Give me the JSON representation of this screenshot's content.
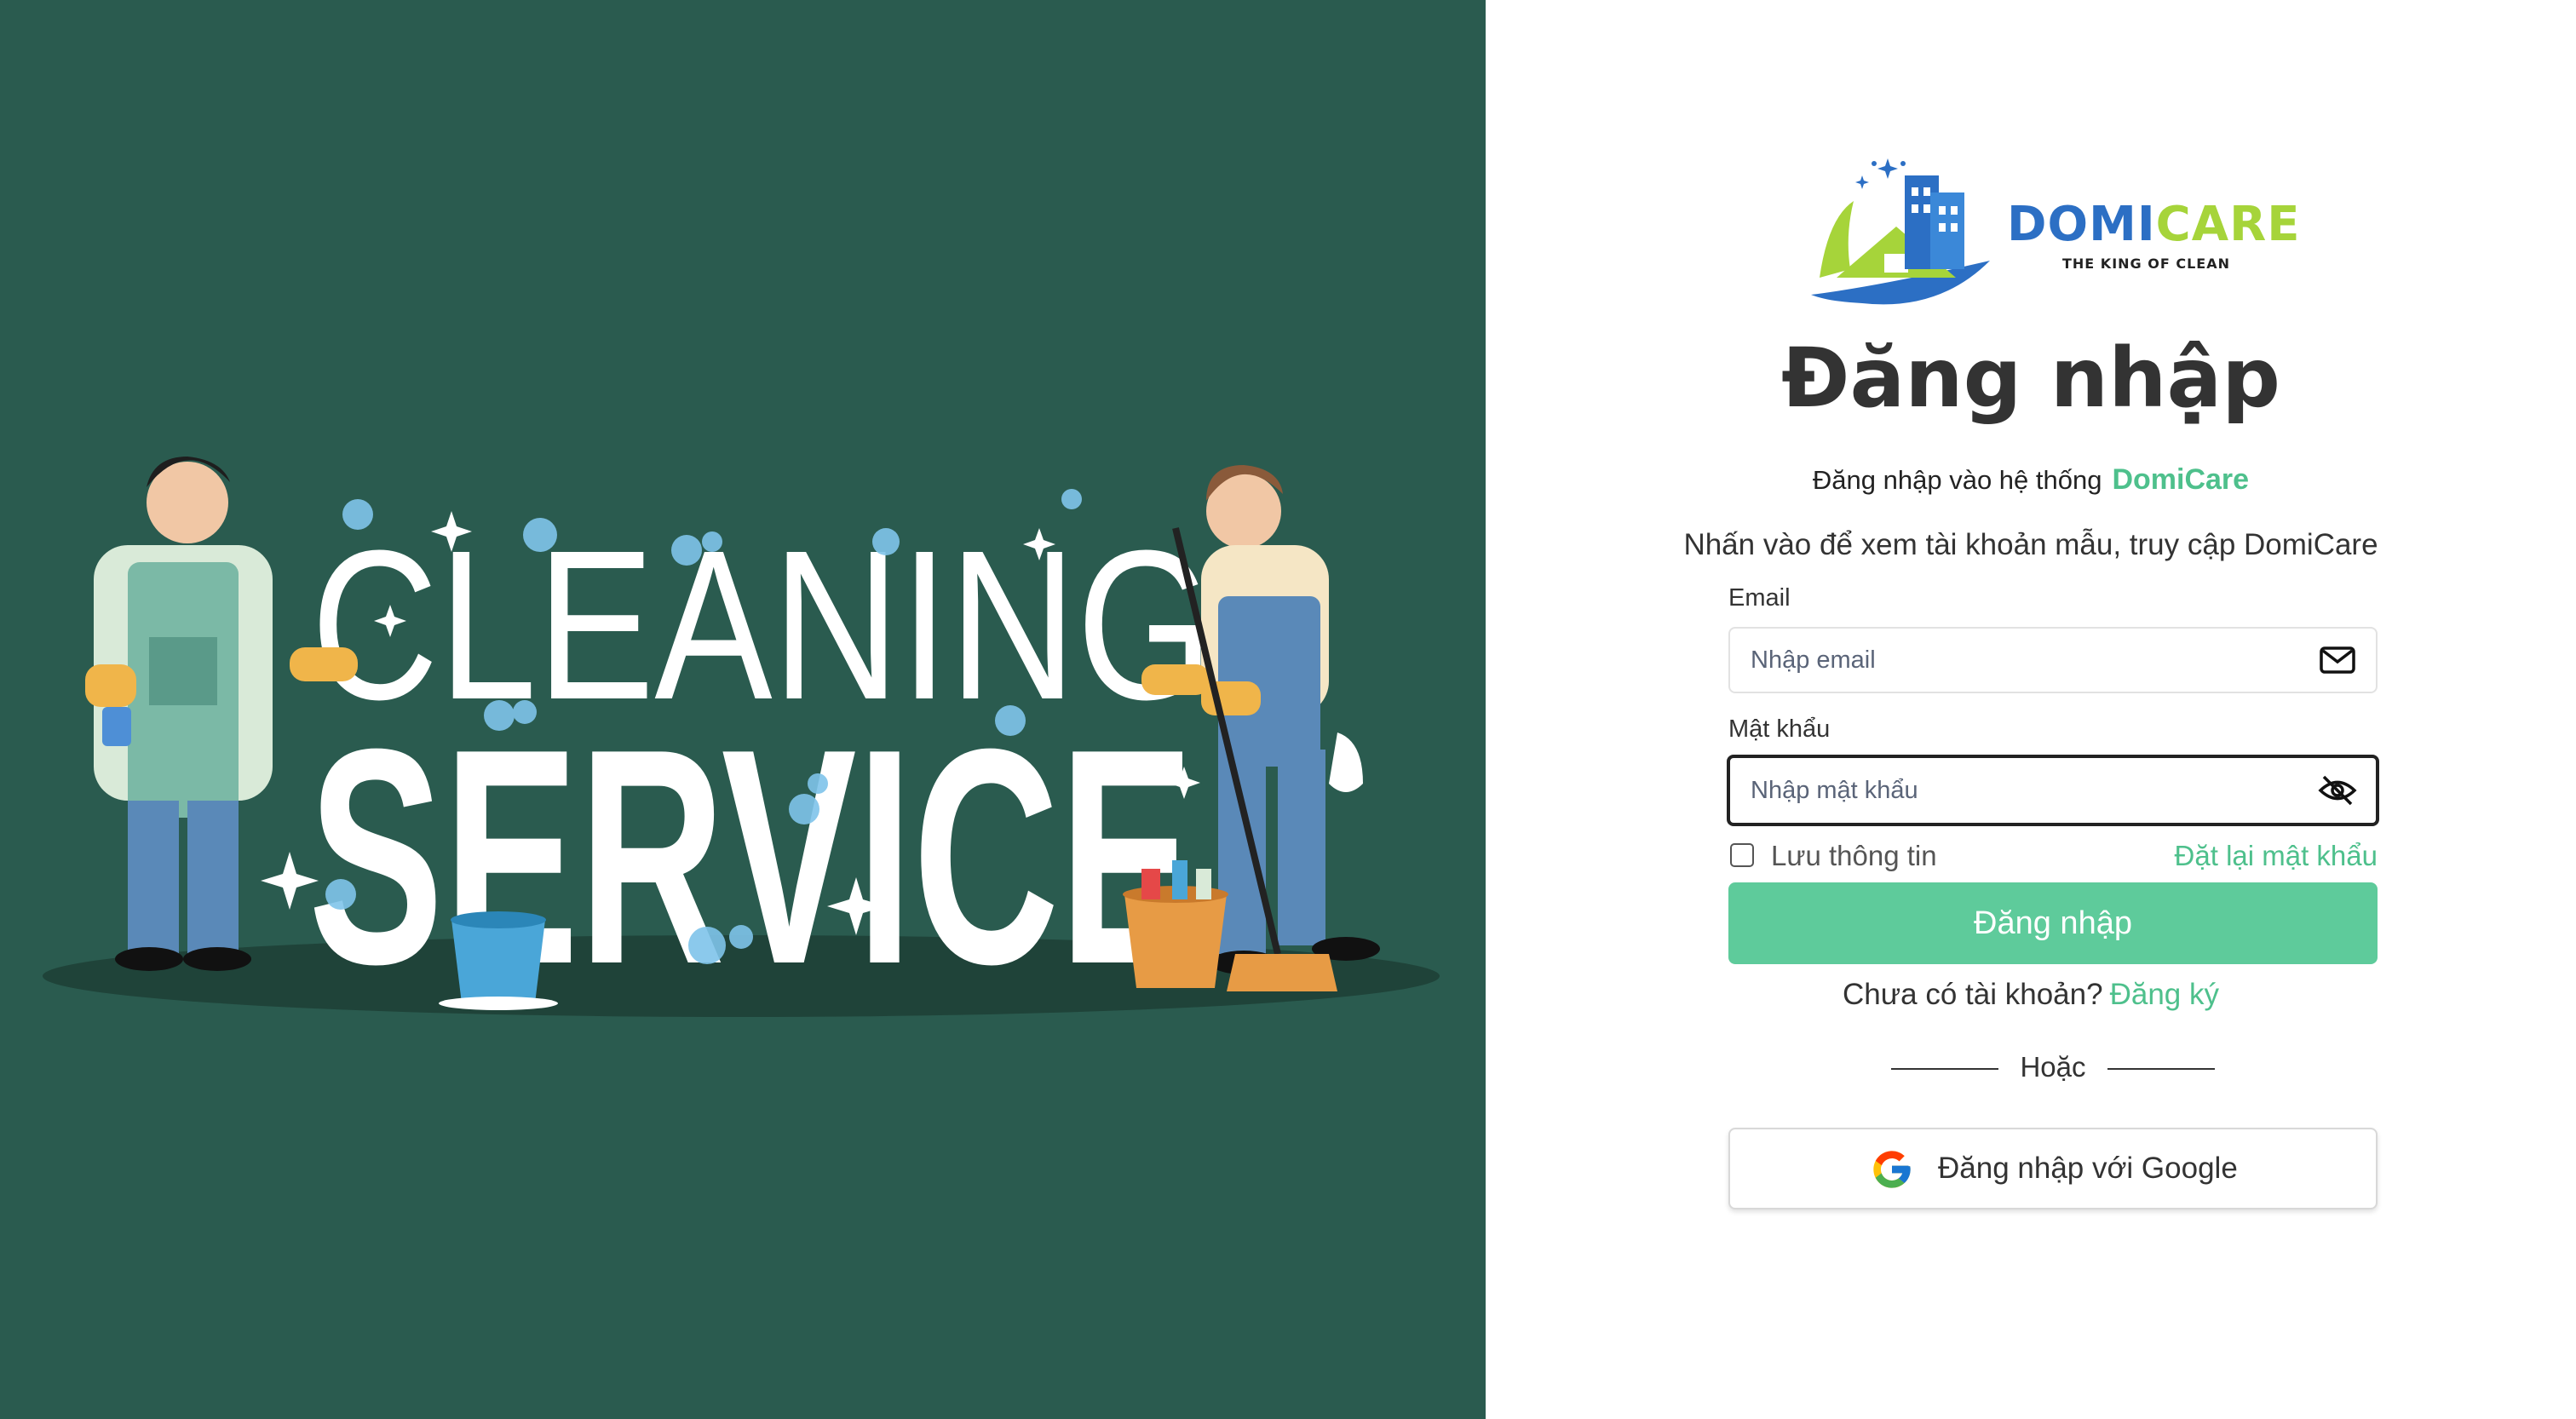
{
  "hero": {
    "headline_line1": "CLEANING",
    "headline_line2": "SERVICE",
    "background_color": "#2a5b4f"
  },
  "logo": {
    "word_part1": "DOMI",
    "word_part2": "CARE",
    "tagline": "THE KING OF CLEAN"
  },
  "login": {
    "title": "Đăng nhập",
    "subtitle": "Đăng nhập vào hệ thống",
    "brand": "DomiCare",
    "hint": "Nhấn vào để xem tài khoản mẫu, truy cập DomiCare",
    "email_label": "Email",
    "email_placeholder": "Nhập email",
    "password_label": "Mật khẩu",
    "password_placeholder": "Nhập mật khẩu",
    "remember_label": "Lưu thông tin",
    "forgot_link": "Đặt lại mật khẩu",
    "submit_label": "Đăng nhập",
    "no_account_text": "Chưa có tài khoản?",
    "signup_link": "Đăng ký",
    "divider_text": "Hoặc",
    "google_label": "Đăng nhập với Google"
  },
  "icons": {
    "email": "mail-icon",
    "password_toggle": "eye-off-icon",
    "google": "google-icon"
  },
  "colors": {
    "accent": "#4ec08c",
    "button": "#5ecb9b",
    "logo_blue": "#2c6fc4",
    "logo_green": "#a6d43a"
  }
}
